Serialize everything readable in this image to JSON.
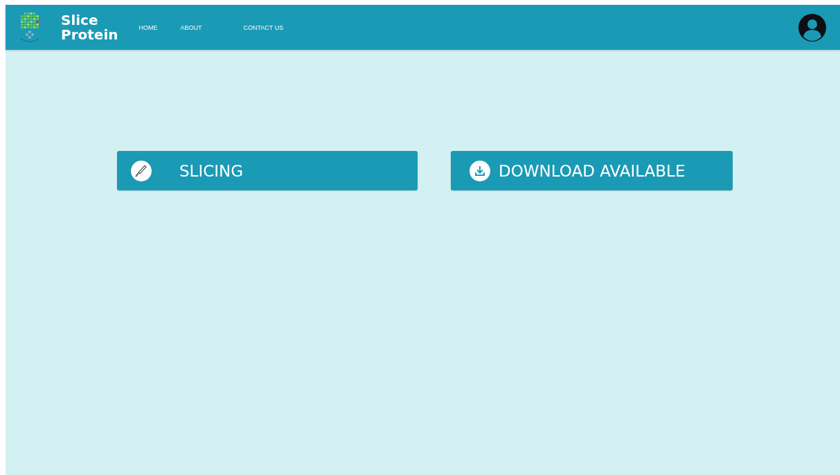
{
  "header": {
    "brand": [
      "Slice",
      "Protein"
    ],
    "nav": [
      {
        "label": "HOME"
      },
      {
        "label": "ABOUT"
      },
      {
        "label": "CONTACT US"
      }
    ]
  },
  "actions": [
    {
      "label": "SLICING",
      "kind": "knife"
    },
    {
      "label": "DOWNLOAD AVAILABLE",
      "kind": "download"
    }
  ]
}
